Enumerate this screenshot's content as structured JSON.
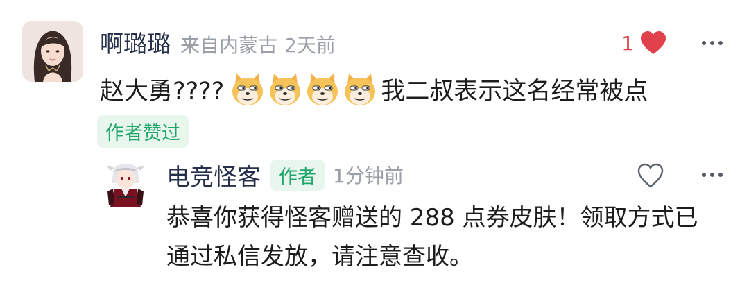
{
  "comment": {
    "username": "啊璐璐",
    "location": "来自内蒙古",
    "time": "2天前",
    "like_count": "1",
    "text_before": "赵大勇????",
    "emoji_name": "doge-emoji",
    "emoji_count": 4,
    "text_after": "我二叔表示这名经常被点",
    "badge": "作者赞过"
  },
  "reply": {
    "username": "电竞怪客",
    "author_tag": "作者",
    "time": "1分钟前",
    "text": "恭喜你获得怪客赠送的 288 点券皮肤！领取方式已通过私信发放，请注意查收。"
  },
  "colors": {
    "username": "#27304a",
    "meta": "#9aa0a6",
    "like": "#e0414c",
    "badge_bg": "#e8f6ee",
    "badge_text": "#20a56a"
  }
}
